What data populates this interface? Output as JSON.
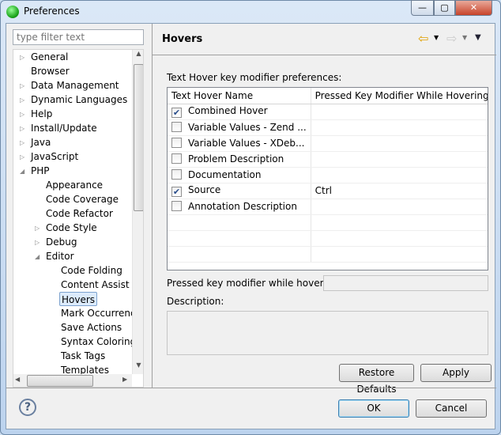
{
  "window": {
    "title": "Preferences",
    "minimize": "—",
    "maximize": "▢",
    "close": "✕"
  },
  "filter": {
    "placeholder": "type filter text"
  },
  "tree": [
    {
      "label": "General",
      "level": 0,
      "twisty": "closed"
    },
    {
      "label": "Browser",
      "level": 0,
      "twisty": "none"
    },
    {
      "label": "Data Management",
      "level": 0,
      "twisty": "closed"
    },
    {
      "label": "Dynamic Languages",
      "level": 0,
      "twisty": "closed"
    },
    {
      "label": "Help",
      "level": 0,
      "twisty": "closed"
    },
    {
      "label": "Install/Update",
      "level": 0,
      "twisty": "closed"
    },
    {
      "label": "Java",
      "level": 0,
      "twisty": "closed"
    },
    {
      "label": "JavaScript",
      "level": 0,
      "twisty": "closed"
    },
    {
      "label": "PHP",
      "level": 0,
      "twisty": "open"
    },
    {
      "label": "Appearance",
      "level": 1,
      "twisty": "none"
    },
    {
      "label": "Code Coverage",
      "level": 1,
      "twisty": "none"
    },
    {
      "label": "Code Refactor",
      "level": 1,
      "twisty": "none"
    },
    {
      "label": "Code Style",
      "level": 1,
      "twisty": "closed"
    },
    {
      "label": "Debug",
      "level": 1,
      "twisty": "closed"
    },
    {
      "label": "Editor",
      "level": 1,
      "twisty": "open"
    },
    {
      "label": "Code Folding",
      "level": 2,
      "twisty": "none"
    },
    {
      "label": "Content Assist",
      "level": 2,
      "twisty": "none"
    },
    {
      "label": "Hovers",
      "level": 2,
      "twisty": "none",
      "selected": true
    },
    {
      "label": "Mark Occurrences",
      "level": 2,
      "twisty": "none"
    },
    {
      "label": "Save Actions",
      "level": 2,
      "twisty": "none"
    },
    {
      "label": "Syntax Coloring",
      "level": 2,
      "twisty": "none"
    },
    {
      "label": "Task Tags",
      "level": 2,
      "twisty": "none"
    },
    {
      "label": "Templates",
      "level": 2,
      "twisty": "none"
    }
  ],
  "page": {
    "title": "Hovers",
    "intro": "Text Hover key modifier preferences:",
    "columns": [
      "Text Hover Name",
      "Pressed Key Modifier While Hovering"
    ],
    "rows": [
      {
        "name": "Combined Hover",
        "checked": true,
        "modifier": ""
      },
      {
        "name": "Variable Values - Zend ...",
        "checked": false,
        "modifier": ""
      },
      {
        "name": "Variable Values - XDeb...",
        "checked": false,
        "modifier": ""
      },
      {
        "name": "Problem Description",
        "checked": false,
        "modifier": ""
      },
      {
        "name": "Documentation",
        "checked": false,
        "modifier": ""
      },
      {
        "name": "Source",
        "checked": true,
        "modifier": "Ctrl"
      },
      {
        "name": "Annotation Description",
        "checked": false,
        "modifier": ""
      }
    ],
    "modifier_label": "Pressed key modifier while hovering:",
    "modifier_value": "",
    "description_label": "Description:",
    "description_value": "",
    "restore": "Restore Defaults",
    "apply": "Apply"
  },
  "footer": {
    "ok": "OK",
    "cancel": "Cancel",
    "help": "?"
  }
}
